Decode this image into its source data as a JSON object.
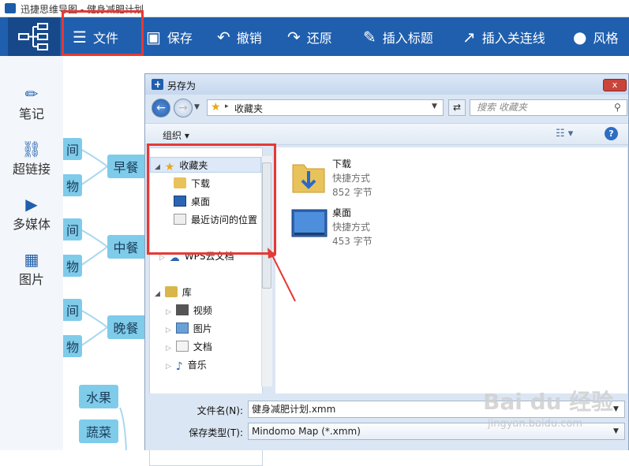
{
  "window": {
    "title": "迅捷思维导图 - 健身减肥计划"
  },
  "toolbar": {
    "menu_label": "文件",
    "save_label": "保存",
    "undo_label": "撤销",
    "redo_label": "还原",
    "insert_title_label": "插入标题",
    "insert_link_label": "插入关连线",
    "style_label": "风格"
  },
  "sidebar": {
    "items": [
      {
        "label": "笔记",
        "icon": "pen-icon"
      },
      {
        "label": "超链接",
        "icon": "link-icon"
      },
      {
        "label": "多媒体",
        "icon": "film-icon"
      },
      {
        "label": "图片",
        "icon": "picture-icon"
      }
    ]
  },
  "mindmap": {
    "meals": [
      "早餐",
      "中餐",
      "晚餐"
    ],
    "side_nodes": [
      "间",
      "物",
      "间",
      "物",
      "间",
      "物"
    ],
    "foods": [
      "水果",
      "蔬菜"
    ]
  },
  "dialog": {
    "title": "另存为",
    "close_label": "x",
    "path": "收藏夹",
    "search_placeholder": "搜索 收藏夹",
    "organize_label": "组织 ▾",
    "help_label": "?",
    "nav": {
      "favorites": "收藏夹",
      "downloads": "下载",
      "desktop": "桌面",
      "recent": "最近访问的位置",
      "wps": "WPS云文档",
      "library": "库",
      "video": "视频",
      "pictures": "图片",
      "documents": "文档",
      "music": "音乐"
    },
    "files": [
      {
        "name": "下载",
        "type": "快捷方式",
        "size": "852 字节"
      },
      {
        "name": "桌面",
        "type": "快捷方式",
        "size": "453 字节"
      }
    ],
    "filename_label": "文件名(N):",
    "filename_value": "健身减肥计划.xmm",
    "filetype_label": "保存类型(T):",
    "filetype_value": "Mindomo Map (*.xmm)"
  },
  "watermark": {
    "brand": "Bai du 经验",
    "url": "jingyan.baidu.com"
  },
  "colors": {
    "toolbar": "#1f5fae",
    "highlight_red": "#e53935",
    "node_fill": "#7fcbea"
  }
}
